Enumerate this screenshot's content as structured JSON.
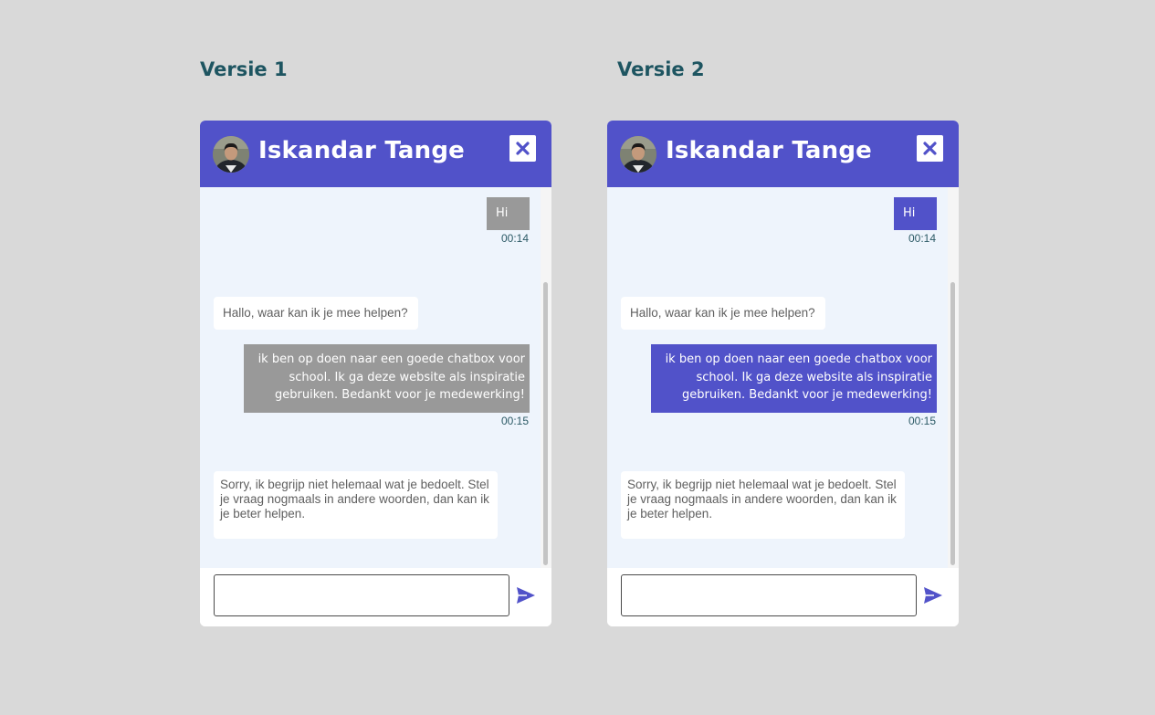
{
  "versions": [
    {
      "title": "Versie 1",
      "variant": "grey",
      "user_bubble_color": "#999999"
    },
    {
      "title": "Versie 2",
      "variant": "purple",
      "user_bubble_color": "#5152c9"
    }
  ],
  "chat": {
    "header_color": "#5152c9",
    "contact_name": "Iskandar Tange",
    "avatar_icon": "profile-photo",
    "close_icon": "close-x-icon",
    "send_icon": "send-paper-plane-icon",
    "input_value": "",
    "input_placeholder": "",
    "messages": [
      {
        "from": "user",
        "text": "Hi",
        "time": "00:14"
      },
      {
        "from": "bot",
        "text": "Hallo, waar kan ik je mee helpen?"
      },
      {
        "from": "user",
        "text": "ik ben op doen naar een goede chatbox voor school. Ik ga deze website als inspiratie gebruiken. Bedankt voor je medewerking!",
        "time": "00:15"
      },
      {
        "from": "bot",
        "text": "Sorry, ik begrijp niet helemaal wat je bedoelt. Stel je vraag nogmaals in andere woorden, dan kan ik je beter helpen."
      }
    ]
  }
}
